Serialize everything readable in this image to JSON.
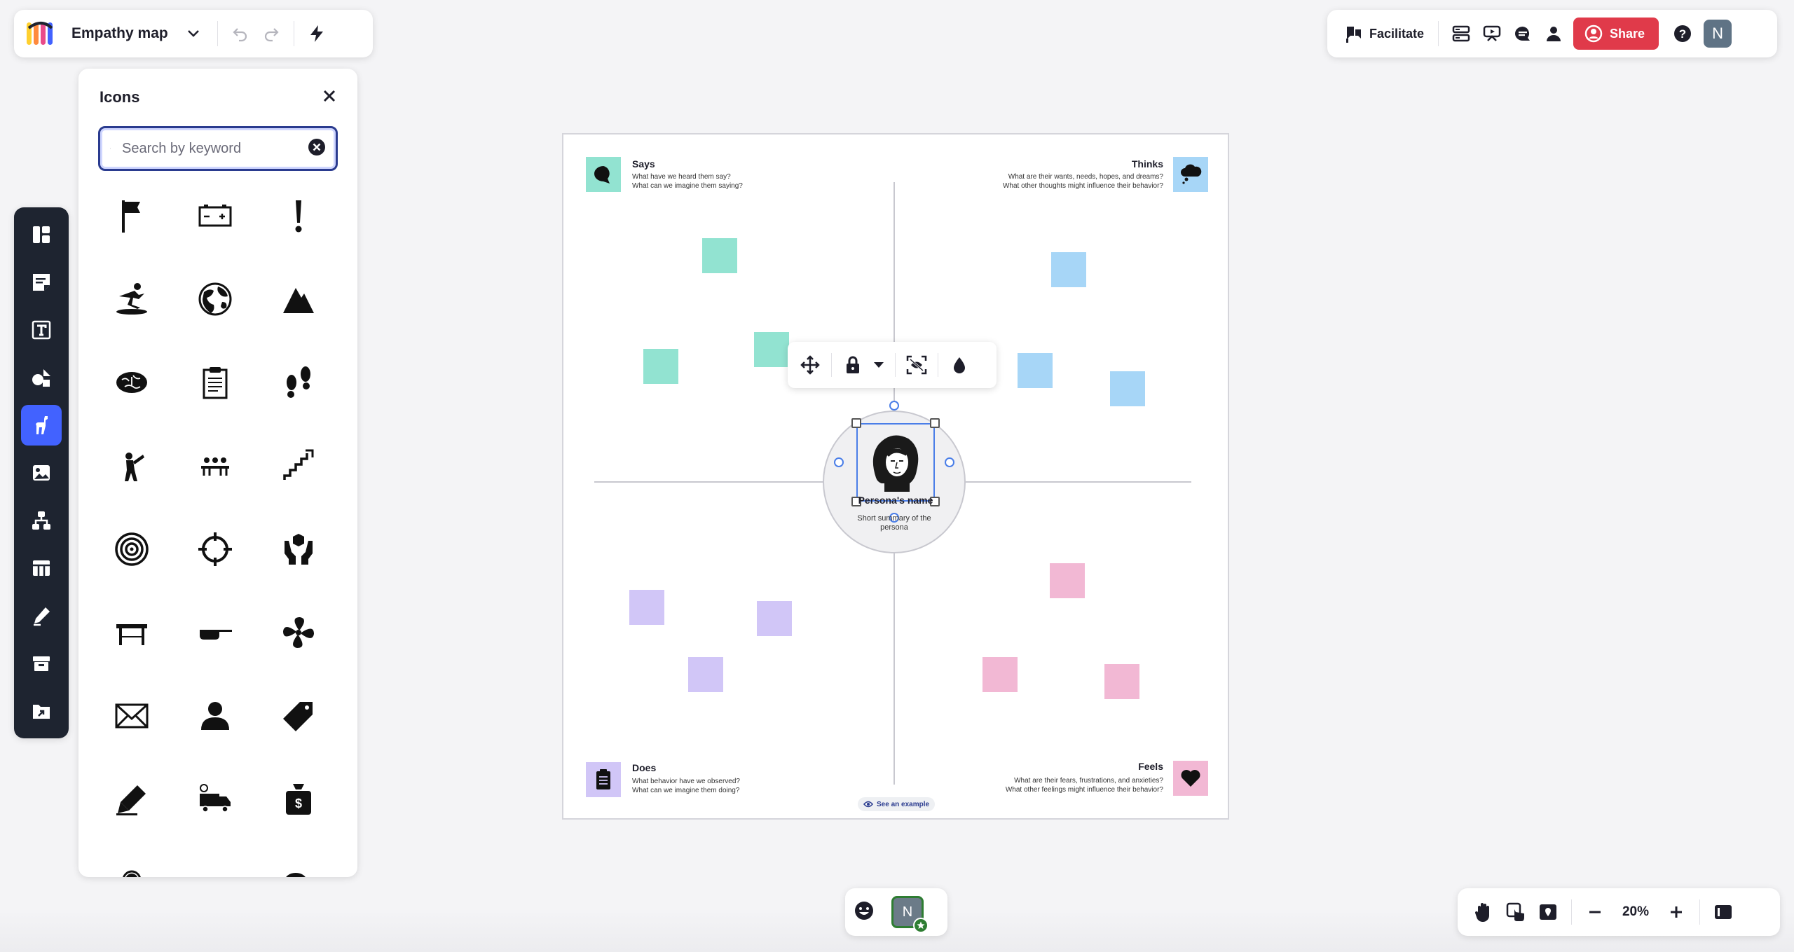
{
  "header": {
    "board_title": "Empathy map"
  },
  "topbar_right": {
    "facilitate_label": "Facilitate",
    "share_label": "Share",
    "user_initial": "N"
  },
  "icons_panel": {
    "title": "Icons",
    "search_placeholder": "Search by keyword",
    "icons": [
      "flag-icon",
      "battery-icon",
      "exclamation-icon",
      "surfer-icon",
      "globe-icon",
      "mountain-icon",
      "brain-icon",
      "clipboard-icon",
      "footprints-icon",
      "explorer-icon",
      "meeting-icon",
      "stairs-icon",
      "target-icon",
      "crosshair-icon",
      "hands-icon",
      "table-icon",
      "pan-icon",
      "fan-icon",
      "envelope-icon",
      "person-icon",
      "tag-icon",
      "pen-icon",
      "truck-icon",
      "moneybag-icon",
      "support-icon",
      "car-icon",
      "chat-icon"
    ]
  },
  "board": {
    "says": {
      "title": "Says",
      "line1": "What have we heard them say?",
      "line2": "What can we imagine them saying?",
      "color": "#92e3d1"
    },
    "thinks": {
      "title": "Thinks",
      "line1": "What are their wants, needs, hopes, and dreams?",
      "line2": "What other thoughts might influence their behavior?",
      "color": "#a7d6f7"
    },
    "does": {
      "title": "Does",
      "line1": "What behavior have we observed?",
      "line2": "What can we imagine them doing?",
      "color": "#d1c6f7"
    },
    "feels": {
      "title": "Feels",
      "line1": "What are their fears, frustrations, and anxieties?",
      "line2": "What other feelings might influence their behavior?",
      "color": "#f2b8d4"
    },
    "persona": {
      "name": "Persona's name",
      "summary": "Short summary of the persona"
    },
    "see_example": "See an example"
  },
  "bottom_center": {
    "user_initial": "N"
  },
  "zoom": {
    "level": "20%"
  }
}
